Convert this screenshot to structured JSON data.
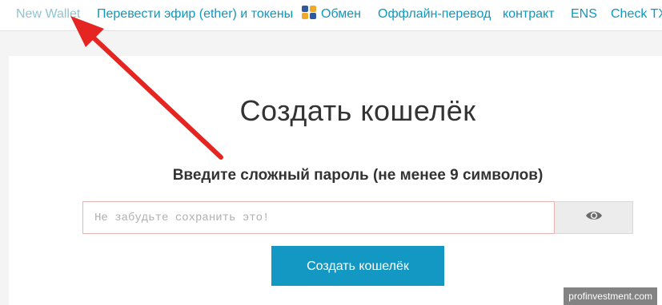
{
  "nav": {
    "items": [
      {
        "label": "New Wallet"
      },
      {
        "label": "Перевести эфир (ether) и токены"
      },
      {
        "label": "Обмен"
      },
      {
        "label": "Оффлайн-перевод"
      },
      {
        "label": "контракт"
      },
      {
        "label": "ENS"
      },
      {
        "label": "Check TX"
      }
    ],
    "active_index": 0,
    "swap_icon": "swap-icon"
  },
  "main": {
    "title": "Создать кошелёк",
    "subtitle": "Введите сложный пароль (не менее 9 символов)",
    "password": {
      "placeholder": "Не забудьте сохранить это!",
      "value": ""
    },
    "toggle_icon": "eye-icon",
    "create_button_label": "Создать кошелёк"
  },
  "annotation": {
    "arrow_color": "#e52521",
    "arrow_icon": "arrow-icon"
  },
  "watermark": "profinvestment.com",
  "colors": {
    "accent": "#1298c3",
    "nav_link": "#0e97c0",
    "nav_active": "#8fc4d3",
    "input_border": "#e8b5b0"
  }
}
